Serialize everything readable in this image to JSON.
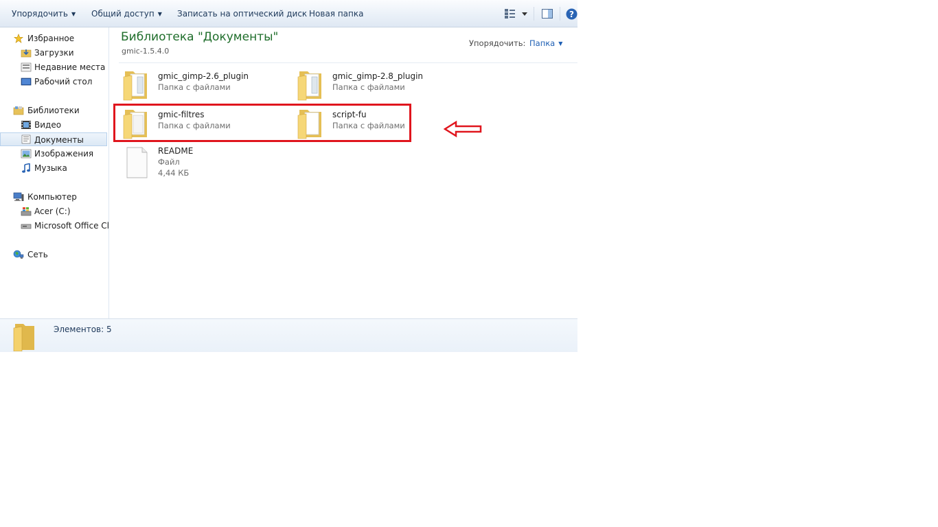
{
  "toolbar": {
    "organize": "Упорядочить",
    "share": "Общий доступ",
    "burn": "Записать на оптический диск",
    "new_folder": "Новая папка"
  },
  "nav": {
    "favorites": "Избранное",
    "downloads": "Загрузки",
    "recent": "Недавние места",
    "desktop": "Рабочий стол",
    "libraries": "Библиотеки",
    "video": "Видео",
    "documents": "Документы",
    "images": "Изображения",
    "music": "Музыка",
    "computer": "Компьютер",
    "drive_c": "Acer (C:)",
    "office": "Microsoft Office Clic",
    "network": "Сеть"
  },
  "content": {
    "title": "Библиотека \"Документы\"",
    "subtitle": "gmic-1.5.4.0",
    "arrange_label": "Упорядочить:",
    "arrange_value": "Папка"
  },
  "files": [
    {
      "name": "gmic_gimp-2.6_plugin",
      "kind": "Папка с файлами"
    },
    {
      "name": "gmic_gimp-2.8_plugin",
      "kind": "Папка с файлами"
    },
    {
      "name": "gmic-filtres",
      "kind": "Папка с файлами"
    },
    {
      "name": "script-fu",
      "kind": "Папка с файлами"
    },
    {
      "name": "README",
      "kind": "Файл",
      "size": "4,44 КБ"
    }
  ],
  "status": {
    "count": "Элементов: 5"
  },
  "colors": {
    "title_green": "#1e6d2a",
    "highlight_red": "#e0151d",
    "link_blue": "#1e5fb4"
  }
}
